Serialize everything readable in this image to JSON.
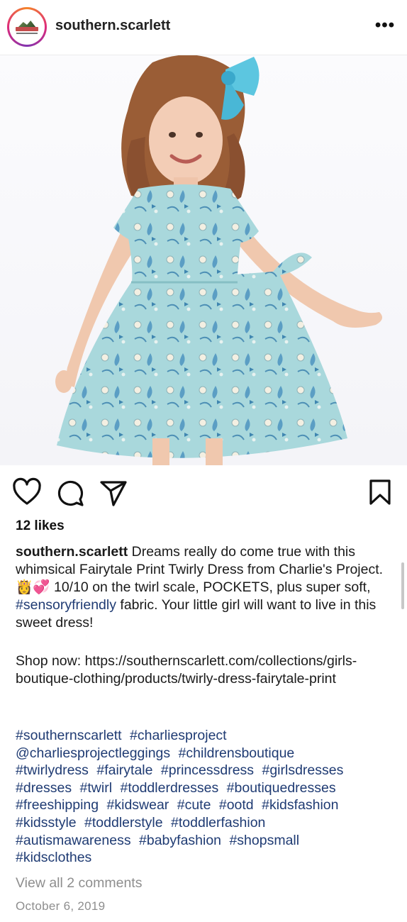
{
  "header": {
    "username": "southern.scarlett",
    "more_icon": "three-dots-horizontal-icon",
    "more_glyph": "•••"
  },
  "post": {
    "image_alt_subject": "girl in fairytale print twirly dress",
    "likes_text": "12 likes",
    "caption_user": "southern.scarlett",
    "caption_part1": " Dreams really do come true with this whimsical Fairytale Print Twirly Dress from Charlie's Project. ",
    "caption_emojis": "👸💞",
    "caption_part2": " 10/10 on the twirl scale, POCKETS, plus super soft, ",
    "caption_tag": "#sensoryfriendly",
    "caption_part3": " fabric. Your little girl will want to live in this sweet dress!",
    "shop_text": "Shop now: https://southernscarlett.com/collections/girls-boutique-clothing/products/twirly-dress-fairytale-print",
    "hashtags": [
      "#southernscarlett",
      "#charliesproject",
      "@charliesprojectleggings",
      "#childrensboutique",
      "#twirlydress",
      "#fairytale",
      "#princessdress",
      "#girlsdresses",
      "#dresses",
      "#twirl",
      "#toddlerdresses",
      "#boutiquedresses",
      "#freeshipping",
      "#kidswear",
      "#cute",
      "#ootd",
      "#kidsfashion",
      "#kidsstyle",
      "#toddlerstyle",
      "#toddlerfashion",
      "#autismawareness",
      "#babyfashion",
      "#shopsmall",
      "#kidsclothes"
    ],
    "view_comments": "View all 2 comments",
    "date": "October 6, 2019"
  },
  "actions": {
    "like_icon": "heart-icon",
    "comment_icon": "comment-bubble-icon",
    "share_icon": "paper-plane-icon",
    "save_icon": "bookmark-icon"
  },
  "colors": {
    "hashtag": "#1f3b73",
    "muted": "#8e8e8e",
    "dress": "#a9d8dc",
    "bow": "#5cc6e0"
  }
}
